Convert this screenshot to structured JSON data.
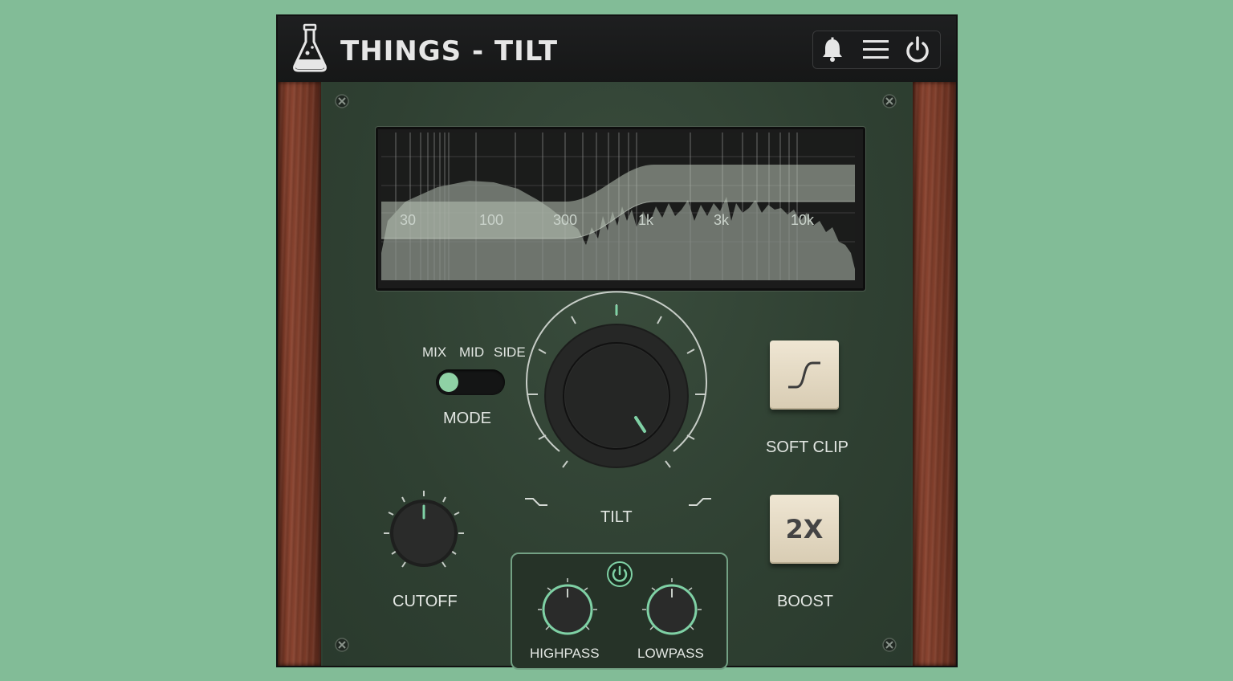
{
  "header": {
    "title": "THINGS - TILT",
    "icons": [
      "flask-logo-icon",
      "bell-icon",
      "menu-icon",
      "power-icon"
    ]
  },
  "display": {
    "freq_labels": [
      "30",
      "100",
      "300",
      "1k",
      "3k",
      "10k"
    ]
  },
  "mode": {
    "options": [
      "MIX",
      "MID",
      "SIDE"
    ],
    "selected": "MIX",
    "label": "MODE"
  },
  "tilt": {
    "label": "TILT",
    "icons": [
      "tilt-low-icon",
      "tilt-high-icon"
    ]
  },
  "soft_clip": {
    "label": "SOFT CLIP",
    "icon": "soft-clip-curve-icon"
  },
  "boost": {
    "button_text": "2X",
    "label": "BOOST"
  },
  "cutoff": {
    "label": "CUTOFF"
  },
  "filter": {
    "highpass_label": "HIGHPASS",
    "lowpass_label": "LOWPASS",
    "icon": "power-icon"
  },
  "colors": {
    "accent": "#7fd1a5",
    "panel": "#2e3f31",
    "background": "#82bc97",
    "button": "#e8dfca"
  }
}
